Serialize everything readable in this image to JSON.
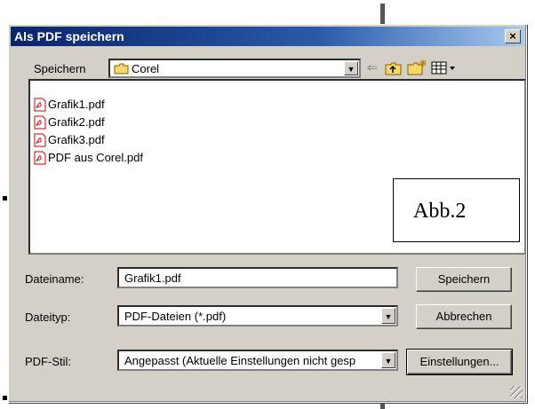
{
  "dialog": {
    "title": "Als PDF speichern",
    "close_label": "×"
  },
  "save_in": {
    "label": "Speichern",
    "folder": "Corel"
  },
  "toolbar": {
    "back_icon": "back-arrow-icon",
    "up_icon": "up-folder-icon",
    "new_folder_icon": "new-folder-icon",
    "view_icon": "view-menu-icon"
  },
  "files": [
    {
      "name": "Grafik1.pdf"
    },
    {
      "name": "Grafik2.pdf"
    },
    {
      "name": "Grafik3.pdf"
    },
    {
      "name": "PDF aus Corel.pdf"
    }
  ],
  "annotation": "Abb.2",
  "filename": {
    "label": "Dateiname:",
    "value": "Grafik1.pdf"
  },
  "filetype": {
    "label": "Dateityp:",
    "value": "PDF-Dateien (*.pdf)"
  },
  "pdfstyle": {
    "label": "PDF-Stil:",
    "value": "Angepasst (Aktuelle Einstellungen nicht gesp"
  },
  "buttons": {
    "save": "Speichern",
    "cancel": "Abbrechen",
    "settings": "Einstellungen..."
  },
  "colors": {
    "title_start": "#0a246a",
    "title_end": "#a6caf0",
    "face": "#d4d0c8",
    "pdf_red": "#cc0000"
  }
}
